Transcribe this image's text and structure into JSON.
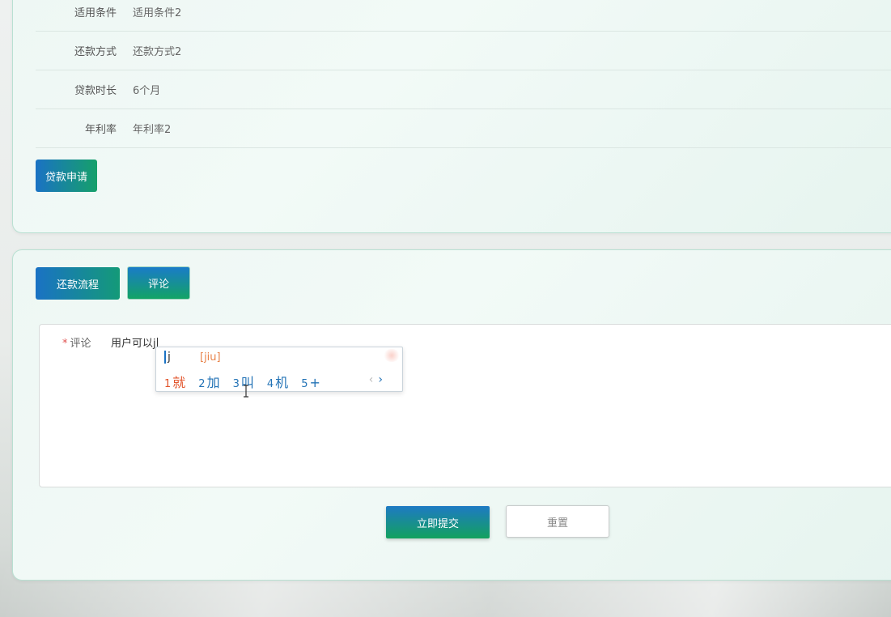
{
  "details": [
    {
      "label": "适用条件",
      "value": "适用条件2"
    },
    {
      "label": "还款方式",
      "value": "还款方式2"
    },
    {
      "label": "贷款时长",
      "value": "6个月"
    },
    {
      "label": "年利率",
      "value": "年利率2"
    }
  ],
  "loan_apply_label": "贷款申请",
  "tabs": {
    "repay_flow": "还款流程",
    "comment": "评论"
  },
  "comment": {
    "required_mark": "*",
    "label": "评论",
    "value": "用户可以j"
  },
  "ime": {
    "input": "j",
    "pinyin": "[jiu]",
    "candidates": [
      {
        "num": "1",
        "text": "就"
      },
      {
        "num": "2",
        "text": "加"
      },
      {
        "num": "3",
        "text": "叫"
      },
      {
        "num": "4",
        "text": "机"
      },
      {
        "num": "5",
        "text": "+"
      }
    ],
    "prev": "‹",
    "next": "›"
  },
  "actions": {
    "submit": "立即提交",
    "reset": "重置"
  }
}
